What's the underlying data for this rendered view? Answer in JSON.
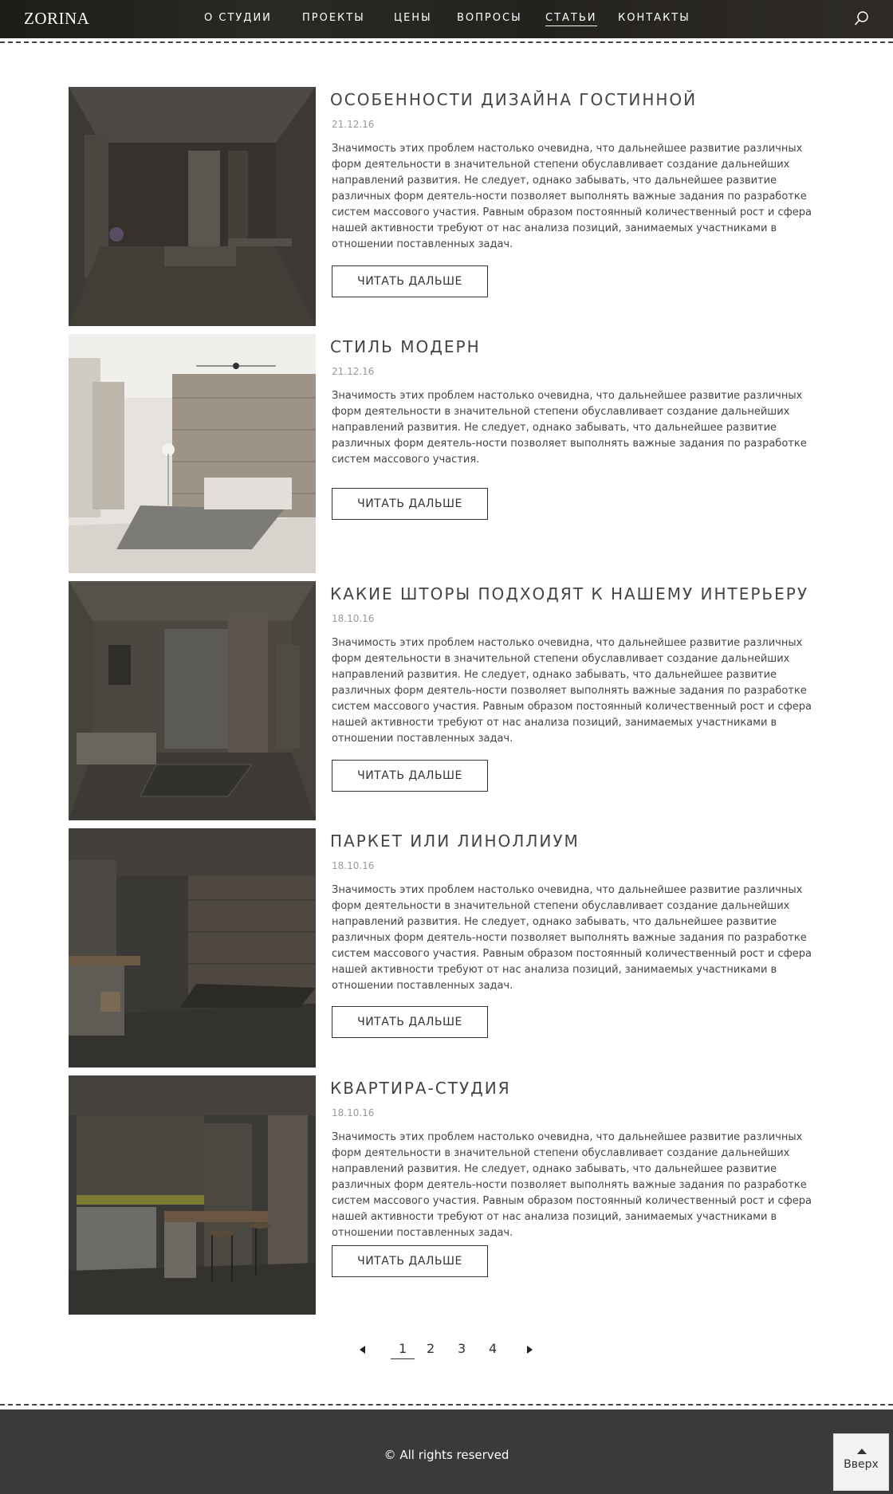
{
  "header": {
    "logo": "ZORINA",
    "nav": [
      {
        "label": "О СТУДИИ",
        "active": false
      },
      {
        "label": "ПРОЕКТЫ",
        "active": false
      },
      {
        "label": "ЦЕНЫ",
        "active": false
      },
      {
        "label": "ВОПРОСЫ",
        "active": false
      },
      {
        "label": "СТАТЬИ",
        "active": true
      },
      {
        "label": "КОНТАКТЫ",
        "active": false
      }
    ],
    "search_icon": "search-icon"
  },
  "articles": [
    {
      "title": "ОСОБЕННОСТИ ДИЗАЙНА ГОСТИННОЙ",
      "date": "21.12.16",
      "excerpt": "Значимость этих проблем настолько очевидна, что дальнейшее развитие различных форм деятельности в значительной степени обуславливает создание дальнейших направлений развития. Не следует, однако забывать, что дальнейшее развитие различных форм деятель-ности позволяет выполнять важные задания по разработке систем массового участия. Равным образом постоянный количественный рост и сфера нашей активности требуют от нас анализа позиций, занимаемых участниками в отношении поставленных задач.",
      "button": "ЧИТАТЬ ДАЛЬШЕ"
    },
    {
      "title": "СТИЛЬ МОДЕРН",
      "date": "21.12.16",
      "excerpt": "Значимость этих проблем настолько очевидна, что дальнейшее развитие различных форм деятельности в значительной степени обуславливает создание дальнейших направлений развития. Не следует, однако забывать, что дальнейшее развитие различных форм деятель-ности позволяет выполнять важные задания по разработке систем массового участия.",
      "button": "ЧИТАТЬ ДАЛЬШЕ"
    },
    {
      "title": "КАКИЕ ШТОРЫ ПОДХОДЯТ К НАШЕМУ ИНТЕРЬЕРУ",
      "date": "18.10.16",
      "excerpt": "Значимость этих проблем настолько очевидна, что дальнейшее развитие различных форм деятельности в значительной степени обуславливает создание дальнейших направлений развития. Не следует, однако забывать, что дальнейшее развитие различных форм деятель-ности позволяет выполнять важные задания по разработке систем массового участия. Равным образом постоянный количественный рост и сфера нашей активности требуют от нас анализа позиций, занимаемых участниками в отношении поставленных задач.",
      "button": "ЧИТАТЬ ДАЛЬШЕ"
    },
    {
      "title": "ПАРКЕТ ИЛИ ЛИНОЛЛИУМ",
      "date": "18.10.16",
      "excerpt": "Значимость этих проблем настолько очевидна, что дальнейшее развитие различных форм деятельности в значительной степени обуславливает создание дальнейших направлений развития. Не следует, однако забывать, что дальнейшее развитие различных форм деятель-ности позволяет выполнять важные задания по разработке систем массового участия. Равным образом постоянный количественный рост и сфера нашей активности требуют от нас анализа позиций, занимаемых участниками в отношении поставленных задач.",
      "button": "ЧИТАТЬ ДАЛЬШЕ"
    },
    {
      "title": "КВАРТИРА-СТУДИЯ",
      "date": "18.10.16",
      "excerpt": "Значимость этих проблем настолько очевидна, что дальнейшее развитие различных форм деятельности в значительной степени обуславливает создание дальнейших направлений развития. Не следует, однако забывать, что дальнейшее развитие различных форм деятель-ности позволяет выполнять важные задания по разработке систем массового участия. Равным образом постоянный количественный рост и сфера нашей активности требуют от нас анализа позиций, занимаемых участниками в отношении поставленных задач.",
      "button": "ЧИТАТЬ ДАЛЬШЕ"
    }
  ],
  "pagination": {
    "pages": [
      "1",
      "2",
      "3",
      "4"
    ],
    "current": "1",
    "prev_icon": "triangle-left-icon",
    "next_icon": "triangle-right-icon"
  },
  "footer": {
    "copyright": "© All rights reserved",
    "to_top": "Вверх",
    "to_top_icon": "triangle-up-icon"
  },
  "colors": {
    "header_bg": "#2a2825",
    "footer_bg": "#3a3a3a",
    "text": "#444444",
    "date": "#999999"
  }
}
